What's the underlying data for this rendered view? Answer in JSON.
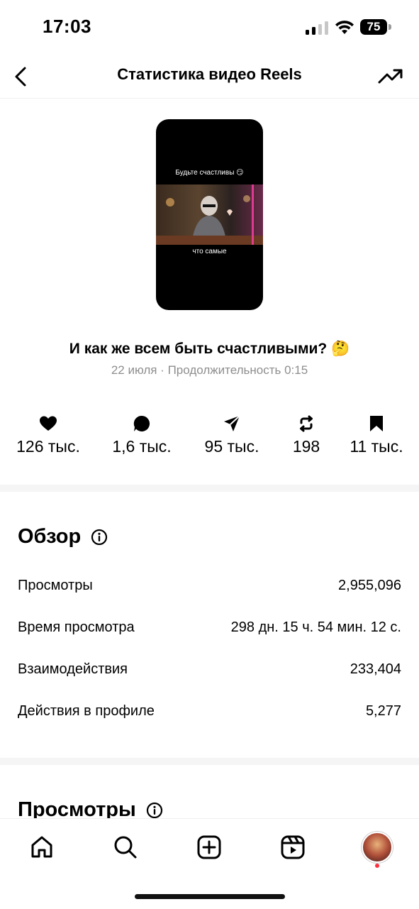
{
  "status_bar": {
    "time": "17:03",
    "battery": "75"
  },
  "nav": {
    "title": "Статистика видео Reels"
  },
  "video": {
    "top_text": "Будьте счастливы 😏",
    "bottom_text": "что самые"
  },
  "post": {
    "caption": "И как же всем быть счастливыми? 🤔",
    "meta": "22 июля · Продолжительность 0:15"
  },
  "metrics": [
    {
      "icon": "heart-icon",
      "value": "126 тыс."
    },
    {
      "icon": "comment-icon",
      "value": "1,6 тыс."
    },
    {
      "icon": "share-icon",
      "value": "95 тыс."
    },
    {
      "icon": "repost-icon",
      "value": "198"
    },
    {
      "icon": "bookmark-icon",
      "value": "11 тыс."
    }
  ],
  "overview": {
    "title": "Обзор",
    "rows": [
      {
        "label": "Просмотры",
        "value": "2,955,096"
      },
      {
        "label": "Время просмотра",
        "value": "298 дн. 15 ч. 54 мин. 12 с."
      },
      {
        "label": "Взаимодействия",
        "value": "233,404"
      },
      {
        "label": "Действия в профиле",
        "value": "5,277"
      }
    ]
  },
  "views_section": {
    "title": "Просмотры"
  },
  "tabbar": [
    "home-icon",
    "search-icon",
    "create-icon",
    "reels-icon",
    "profile-avatar"
  ],
  "colors": {
    "notification": "#ff3040",
    "secondary_text": "#8e8e8e"
  }
}
